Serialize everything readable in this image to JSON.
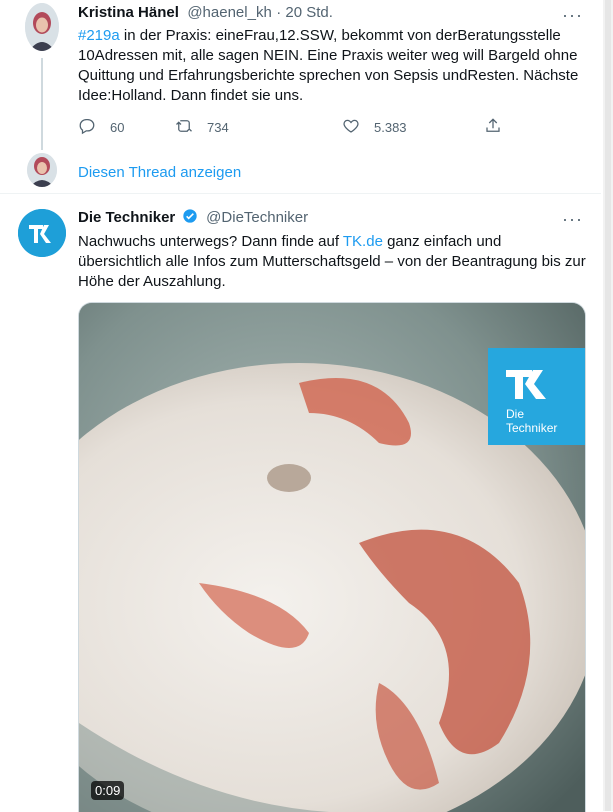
{
  "tweet1": {
    "name": "Kristina Hänel",
    "handle": "@haenel_kh",
    "time": "· 20 Std.",
    "hashtag": "#219a",
    "text": " in der Praxis: eineFrau,12.SSW, bekommt von derBeratungsstelle 10Adressen mit, alle sagen NEIN. Eine Praxis weiter weg will Bargeld ohne Quittung und Erfahrungsberichte sprechen von  Sepsis undResten. Nächste Idee:Holland. Dann findet sie uns.",
    "actions": {
      "reply_count": "60",
      "retweet_count": "734",
      "like_count": "5.383"
    }
  },
  "thread_link": "Diesen Thread anzeigen",
  "tweet2": {
    "name": "Die Techniker",
    "handle": "@DieTechniker",
    "text_before": "Nachwuchs unterwegs? Dann finde auf ",
    "link": "TK.de",
    "text_after": " ganz einfach und übersichtlich alle Infos zum Mutterschaftsgeld – von der Beantragung bis zur Höhe der Auszahlung.",
    "video_duration": "0:09",
    "brand": {
      "logo_text_1": "Die",
      "logo_text_2": "Techniker",
      "badge_color": "#26a7de"
    }
  },
  "colors": {
    "accent": "#1d9bf0",
    "muted": "#536471"
  }
}
